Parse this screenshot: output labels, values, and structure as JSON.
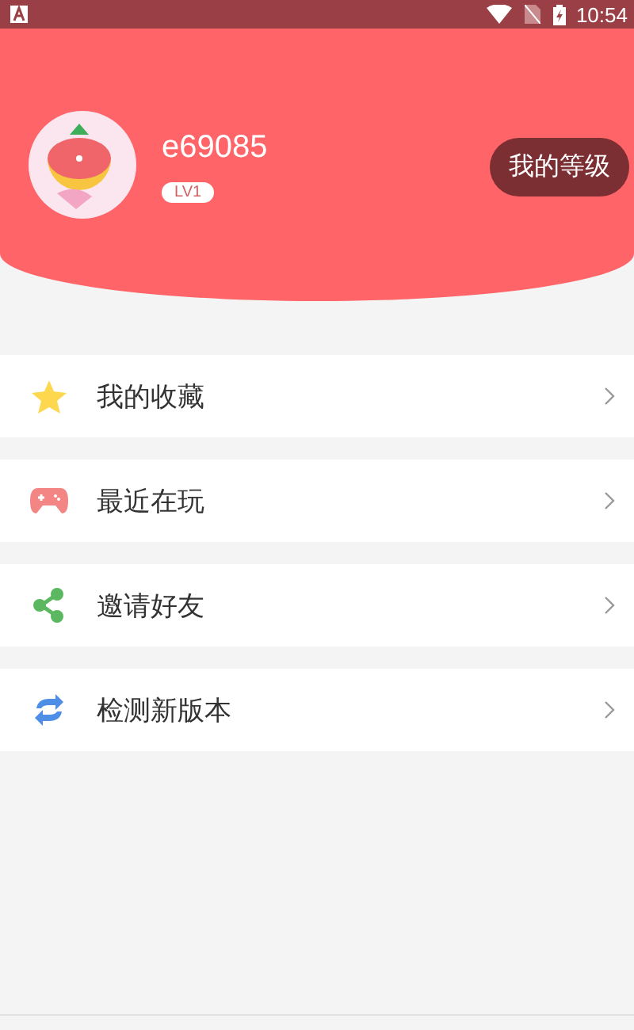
{
  "status_bar": {
    "time": "10:54"
  },
  "profile": {
    "username": "e69085",
    "level_badge": "LV1",
    "level_button": "我的等级"
  },
  "menu": [
    {
      "kind": "star",
      "label": "我的收藏"
    },
    {
      "kind": "gamepad",
      "label": "最近在玩"
    },
    {
      "kind": "share",
      "label": "邀请好友"
    },
    {
      "kind": "refresh",
      "label": "检测新版本"
    }
  ]
}
